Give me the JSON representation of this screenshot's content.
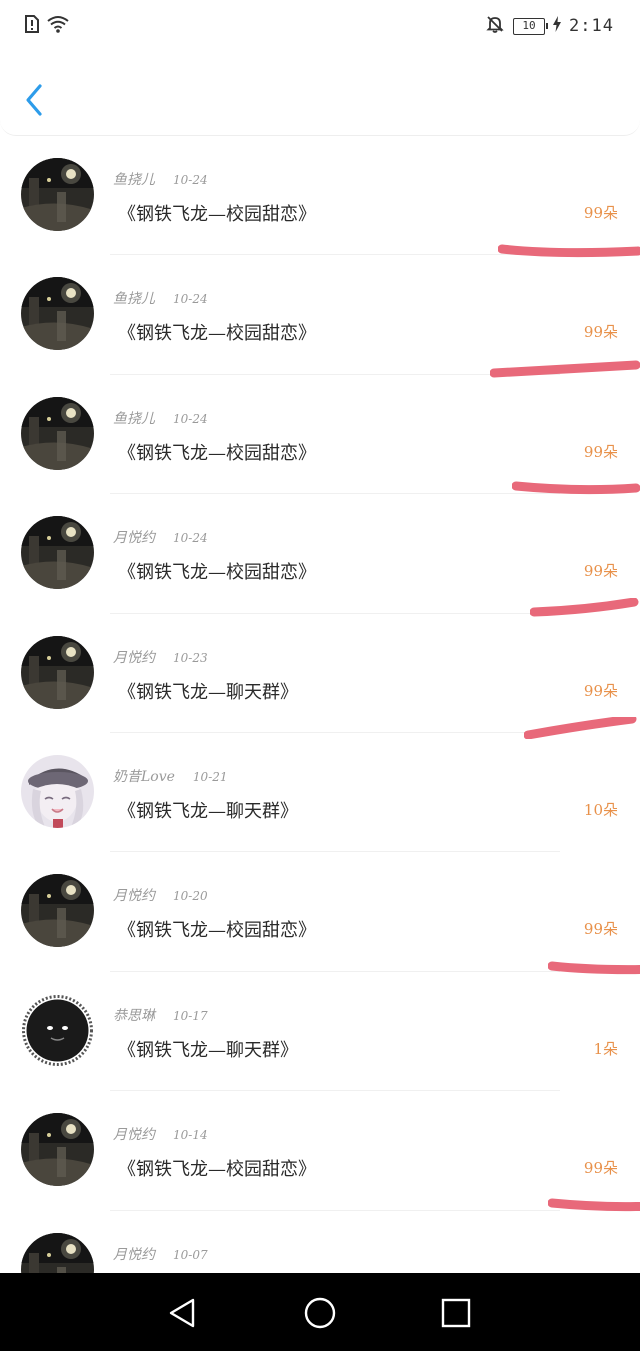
{
  "status_bar": {
    "time": "2:14",
    "battery": "10",
    "icons": [
      "sim-alert-icon",
      "wifi-icon",
      "bell-off-icon",
      "battery-icon",
      "charging-icon"
    ]
  },
  "header": {
    "back_icon": "chevron-left-icon"
  },
  "accent_colors": {
    "back": "#2d9cea",
    "amount": "#e8914a",
    "scribble": "#e8697a"
  },
  "records": [
    {
      "name": "鱼挠儿",
      "date": "10-24",
      "title": "《钢铁飞龙—校园甜恋》",
      "amount": "99朵",
      "avatar": "night-street",
      "scribbled": true
    },
    {
      "name": "鱼挠儿",
      "date": "10-24",
      "title": "《钢铁飞龙—校园甜恋》",
      "amount": "99朵",
      "avatar": "night-street",
      "scribbled": true
    },
    {
      "name": "鱼挠儿",
      "date": "10-24",
      "title": "《钢铁飞龙—校园甜恋》",
      "amount": "99朵",
      "avatar": "night-street",
      "scribbled": true
    },
    {
      "name": "月悦约",
      "date": "10-24",
      "title": "《钢铁飞龙—校园甜恋》",
      "amount": "99朵",
      "avatar": "night-street",
      "scribbled": true
    },
    {
      "name": "月悦约",
      "date": "10-23",
      "title": "《钢铁飞龙—聊天群》",
      "amount": "99朵",
      "avatar": "night-street",
      "scribbled": true
    },
    {
      "name": "奶昔Love",
      "date": "10-21",
      "title": "《钢铁飞龙—聊天群》",
      "amount": "10朵",
      "avatar": "anime-girl",
      "scribbled": false
    },
    {
      "name": "月悦约",
      "date": "10-20",
      "title": "《钢铁飞龙—校园甜恋》",
      "amount": "99朵",
      "avatar": "night-street",
      "scribbled": true
    },
    {
      "name": "恭思琳",
      "date": "10-17",
      "title": "《钢铁飞龙—聊天群》",
      "amount": "1朵",
      "avatar": "fuzzy-black",
      "scribbled": false
    },
    {
      "name": "月悦约",
      "date": "10-14",
      "title": "《钢铁飞龙—校园甜恋》",
      "amount": "99朵",
      "avatar": "night-street",
      "scribbled": true
    },
    {
      "name": "月悦约",
      "date": "10-07",
      "title": "",
      "amount": "",
      "avatar": "night-street",
      "scribbled": false
    }
  ],
  "nav_bar": {
    "icons": [
      "back-triangle-icon",
      "home-circle-icon",
      "recents-square-icon"
    ]
  }
}
